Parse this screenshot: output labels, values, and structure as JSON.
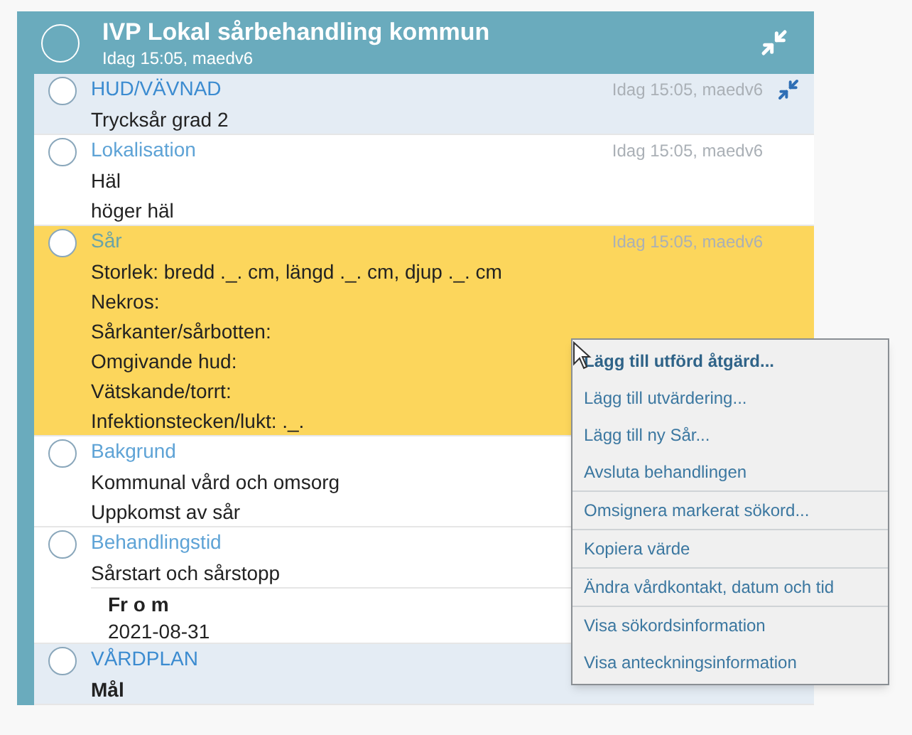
{
  "header": {
    "title": "IVP Lokal sårbehandling kommun",
    "subtitle": "Idag 15:05, maedv6",
    "selected": false
  },
  "rows": [
    {
      "kind": "group",
      "title": "HUD/VÄVNAD",
      "time": "Idag 15:05, maedv6",
      "pinned": true,
      "selected": false,
      "lines": [
        "Trycksår grad 2"
      ]
    },
    {
      "kind": "item",
      "title": "Lokalisation",
      "time": "Idag 15:05, maedv6",
      "pinned": false,
      "selected": false,
      "lines": [
        "Häl",
        "höger häl"
      ]
    },
    {
      "kind": "item",
      "title": "Sår",
      "time": "Idag 15:05, maedv6",
      "pinned": false,
      "selected": true,
      "lines": [
        "Storlek: bredd ._. cm, längd ._. cm, djup ._. cm",
        "Nekros:",
        "Sårkanter/sårbotten:",
        "Omgivande hud:",
        "Vätskande/torrt:",
        "Infektionstecken/lukt: ._."
      ]
    },
    {
      "kind": "item",
      "title": "Bakgrund",
      "pinned": false,
      "selected": false,
      "lines": [
        "Kommunal vård och omsorg",
        "Uppkomst av sår"
      ]
    },
    {
      "kind": "item",
      "title": "Behandlingstid",
      "pinned": false,
      "selected": false,
      "lines": [
        "Sårstart och sårstopp"
      ],
      "sub": {
        "label": "Fr o m",
        "value": "2021-08-31"
      }
    },
    {
      "kind": "group",
      "title": "VÅRDPLAN",
      "pinned": false,
      "selected": false,
      "lines": [
        "Mål"
      ]
    }
  ],
  "menu": {
    "sections": [
      [
        {
          "label": "Lägg till utförd åtgärd...",
          "default": true
        },
        {
          "label": "Lägg till utvärdering...",
          "default": false
        },
        {
          "label": "Lägg till ny Sår...",
          "default": false
        },
        {
          "label": "Avsluta behandlingen",
          "default": false
        }
      ],
      [
        {
          "label": "Omsignera markerat sökord...",
          "default": false
        }
      ],
      [
        {
          "label": "Kopiera värde",
          "default": false
        }
      ],
      [
        {
          "label": "Ändra vårdkontakt, datum och tid",
          "default": false
        }
      ],
      [
        {
          "label": "Visa sökordsinformation",
          "default": false
        },
        {
          "label": "Visa anteckningsinformation",
          "default": false
        }
      ]
    ]
  }
}
